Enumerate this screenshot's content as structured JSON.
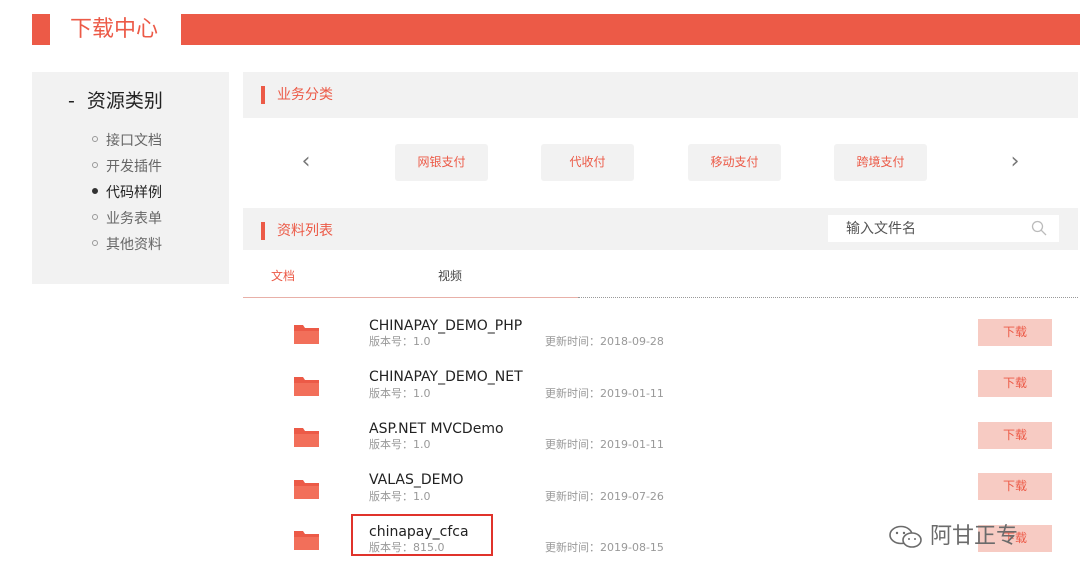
{
  "header": {
    "title": "下载中心"
  },
  "sidebar": {
    "heading_dash": "-",
    "heading": "资源类别",
    "items": [
      {
        "label": "接口文档",
        "active": false
      },
      {
        "label": "开发插件",
        "active": false
      },
      {
        "label": "代码样例",
        "active": true
      },
      {
        "label": "业务表单",
        "active": false
      },
      {
        "label": "其他资料",
        "active": false
      }
    ]
  },
  "business": {
    "title": "业务分类",
    "prev_arrow": "‹",
    "next_arrow": "›",
    "categories": [
      "网银支付",
      "代收付",
      "移动支付",
      "跨境支付"
    ]
  },
  "resources": {
    "title": "资料列表",
    "search_placeholder": "输入文件名",
    "tabs": [
      {
        "label": "文档",
        "active": true
      },
      {
        "label": "视频",
        "active": false
      }
    ],
    "files": [
      {
        "name": "CHINAPAY_DEMO_PHP",
        "version": "版本号：1.0",
        "updated": "更新时间：2018-09-28",
        "download": "下载"
      },
      {
        "name": "CHINAPAY_DEMO_NET",
        "version": "版本号：1.0",
        "updated": "更新时间：2019-01-11",
        "download": "下载"
      },
      {
        "name": "ASP.NET MVCDemo",
        "version": "版本号：1.0",
        "updated": "更新时间：2019-01-11",
        "download": "下载"
      },
      {
        "name": "VALAS_DEMO",
        "version": "版本号：1.0",
        "updated": "更新时间：2019-07-26",
        "download": "下载"
      },
      {
        "name": "chinapay_cfca",
        "version": "版本号：815.0",
        "updated": "更新时间：2019-08-15",
        "download": "下载"
      }
    ]
  },
  "watermark": {
    "text": "阿甘正专"
  },
  "colors": {
    "accent": "#ec5a47",
    "panel": "#f2f2f2",
    "download_bg": "#f7cbc3",
    "highlight": "#e0332b"
  }
}
